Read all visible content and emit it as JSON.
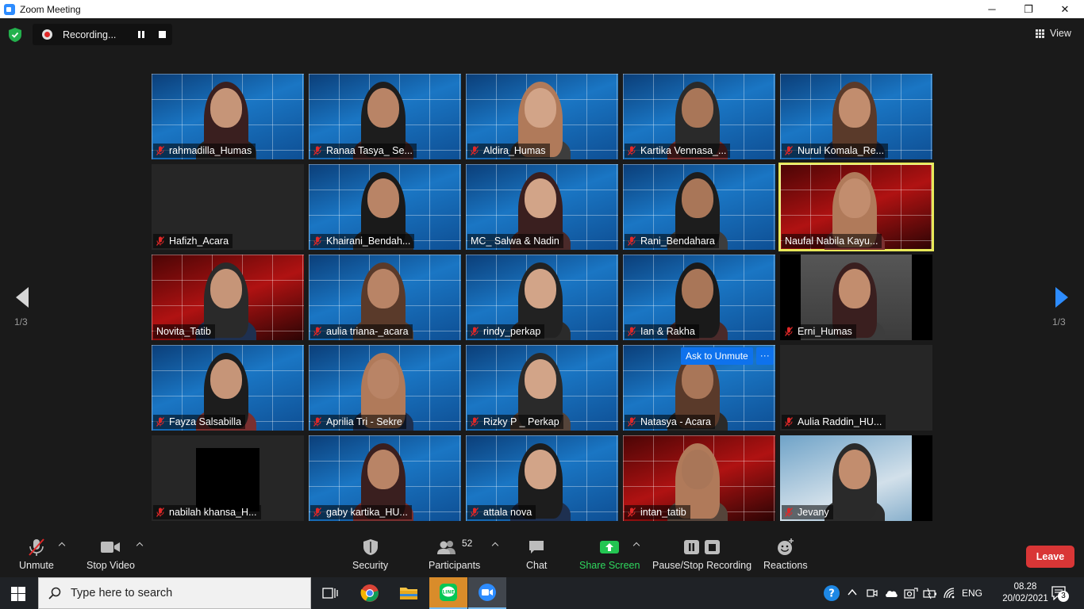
{
  "window": {
    "title": "Zoom Meeting",
    "minimize": "─",
    "maximize": "❐",
    "close": "✕"
  },
  "recording": {
    "label": "Recording..."
  },
  "view_button": {
    "label": "View"
  },
  "pagination": {
    "left": "1/3",
    "right": "1/3"
  },
  "participants_grid": [
    {
      "name": "rahmadilla_Humas",
      "muted": true,
      "bg": "blue"
    },
    {
      "name": "Ranaa Tasya_ Se...",
      "muted": true,
      "bg": "blue"
    },
    {
      "name": "Aldira_Humas",
      "muted": true,
      "bg": "blue"
    },
    {
      "name": "Kartika Vennasa_...",
      "muted": true,
      "bg": "blue"
    },
    {
      "name": "Nurul Komala_Re...",
      "muted": true,
      "bg": "blue"
    },
    {
      "name": "Hafizh_Acara",
      "muted": true,
      "bg": "dark"
    },
    {
      "name": "Khairani_Bendah...",
      "muted": true,
      "bg": "blue"
    },
    {
      "name": "MC_ Salwa & Nadin",
      "muted": false,
      "bg": "blue"
    },
    {
      "name": "Rani_Bendahara",
      "muted": true,
      "bg": "blue"
    },
    {
      "name": "Naufal Nabila Kayu...",
      "muted": false,
      "bg": "red",
      "speaking": true
    },
    {
      "name": "Novita_Tatib",
      "muted": false,
      "bg": "red"
    },
    {
      "name": "aulia triana-_acara",
      "muted": true,
      "bg": "blue"
    },
    {
      "name": "rindy_perkap",
      "muted": true,
      "bg": "blue"
    },
    {
      "name": "Ian & Rakha",
      "muted": true,
      "bg": "blue"
    },
    {
      "name": "Erni_Humas",
      "muted": true,
      "bg": "room"
    },
    {
      "name": "Fayza Salsabilla",
      "muted": true,
      "bg": "blue"
    },
    {
      "name": "Aprilia Tri - Sekre",
      "muted": true,
      "bg": "blue"
    },
    {
      "name": "Rizky P _ Perkap",
      "muted": true,
      "bg": "blue"
    },
    {
      "name": "Natasya - Acara",
      "muted": true,
      "bg": "blue"
    },
    {
      "name": "Aulia Raddin_HU...",
      "muted": true,
      "bg": "dark"
    },
    {
      "name": "nabilah khansa_H...",
      "muted": true,
      "bg": "dark-square"
    },
    {
      "name": "gaby kartika_HU...",
      "muted": true,
      "bg": "blue"
    },
    {
      "name": "attala nova",
      "muted": true,
      "bg": "blue"
    },
    {
      "name": "intan_tatib",
      "muted": true,
      "bg": "red"
    },
    {
      "name": "Jevany",
      "muted": true,
      "bg": "light"
    }
  ],
  "hover_actions": {
    "ask_to_unmute": "Ask to Unmute",
    "more": "···"
  },
  "toolbar": {
    "unmute": "Unmute",
    "stop_video": "Stop Video",
    "security": "Security",
    "participants": "Participants",
    "participants_count": "52",
    "chat": "Chat",
    "share_screen": "Share Screen",
    "pause_stop_recording": "Pause/Stop Recording",
    "reactions": "Reactions",
    "leave": "Leave"
  },
  "taskbar": {
    "search_placeholder": "Type here to search",
    "language": "ENG",
    "time": "08.28",
    "date": "20/02/2021",
    "notification_count": "3"
  },
  "colors": {
    "accent_blue": "#0e72ed",
    "leave_red": "#d93636",
    "share_green": "#2fd85e",
    "speaker_highlight": "#e8e858",
    "mic_muted_red": "#e02828"
  }
}
